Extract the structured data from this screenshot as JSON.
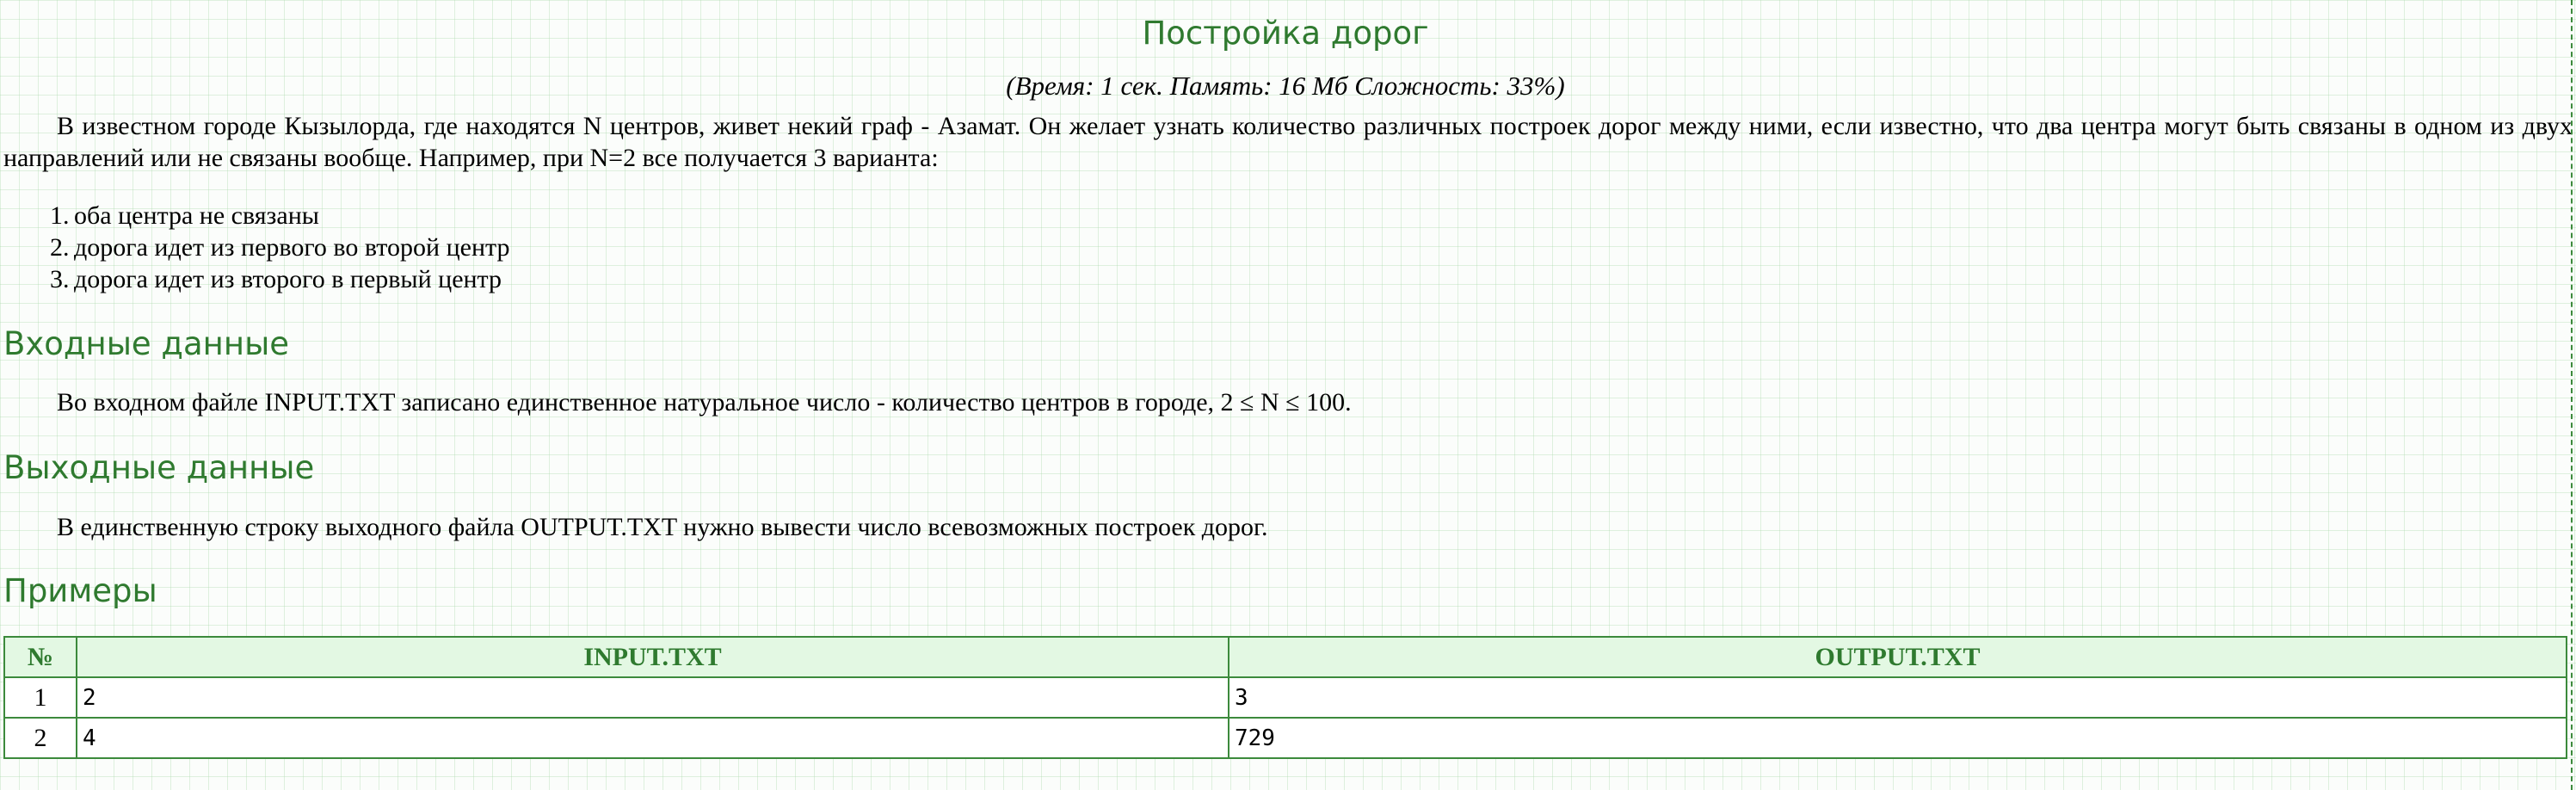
{
  "problem": {
    "title": "Постройка дорог",
    "meta": "(Время: 1 сек. Память: 16 Мб Сложность: 33%)",
    "statement": "В известном городе Кызылорда, где находятся N центров, живет некий граф - Азамат. Он желает узнать количество различных построек дорог между ними, если известно, что два центра могут быть связаны в одном из двух направлений или не связаны вообще. Например, при N=2 все получается 3 варианта:",
    "variants": [
      {
        "num": "1.",
        "text": "оба центра не связаны"
      },
      {
        "num": "2.",
        "text": "дорога идет из первого во второй центр"
      },
      {
        "num": "3.",
        "text": "дорога идет из второго в первый центр"
      }
    ]
  },
  "input_section": {
    "heading": "Входные данные",
    "text": "Во входном файле INPUT.TXT записано единственное натуральное число - количество центров в городе, 2 ≤ N ≤ 100."
  },
  "output_section": {
    "heading": "Выходные данные",
    "text": "В единственную строку выходного файла OUTPUT.TXT нужно вывести число всевозможных построек дорог."
  },
  "examples": {
    "heading": "Примеры",
    "headers": [
      "№",
      "INPUT.TXT",
      "OUTPUT.TXT"
    ],
    "rows": [
      [
        "1",
        "2",
        "3"
      ],
      [
        "2",
        "4",
        "729"
      ]
    ]
  }
}
